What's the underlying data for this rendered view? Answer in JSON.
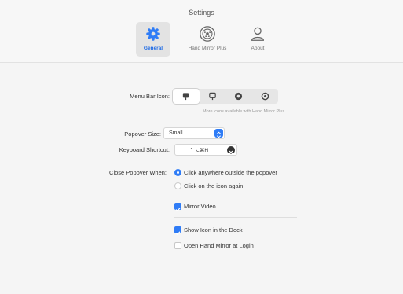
{
  "window": {
    "title": "Settings"
  },
  "tabs": [
    {
      "label": "General",
      "icon": "gear-icon",
      "active": true
    },
    {
      "label": "Hand Mirror Plus",
      "icon": "camera-lens-icon",
      "active": false
    },
    {
      "label": "About",
      "icon": "person-icon",
      "active": false
    }
  ],
  "menu_bar_icon": {
    "label": "Menu Bar Icon:",
    "options": [
      {
        "icon": "mirror-icon",
        "selected": true
      },
      {
        "icon": "mirror-outline-icon",
        "selected": false
      },
      {
        "icon": "lens-icon",
        "selected": false
      },
      {
        "icon": "lens-outline-icon",
        "selected": false
      }
    ],
    "hint": "More icons available with Hand Mirror Plus"
  },
  "popover_size": {
    "label": "Popover Size:",
    "value": "Small"
  },
  "keyboard_shortcut": {
    "label": "Keyboard Shortcut:",
    "value": "⌃⌥⌘H"
  },
  "close_popover": {
    "label": "Close Popover When:",
    "options": [
      {
        "label": "Click anywhere outside the popover",
        "selected": true
      },
      {
        "label": "Click on the icon again",
        "selected": false
      }
    ]
  },
  "mirror_video": {
    "label": "Mirror Video",
    "checked": true
  },
  "show_dock": {
    "label": "Show Icon in the Dock",
    "checked": true
  },
  "open_at_login": {
    "label": "Open Hand Mirror at Login",
    "checked": false
  },
  "colors": {
    "accent": "#2f7cf6",
    "tab_active": "#1d6ae5"
  }
}
